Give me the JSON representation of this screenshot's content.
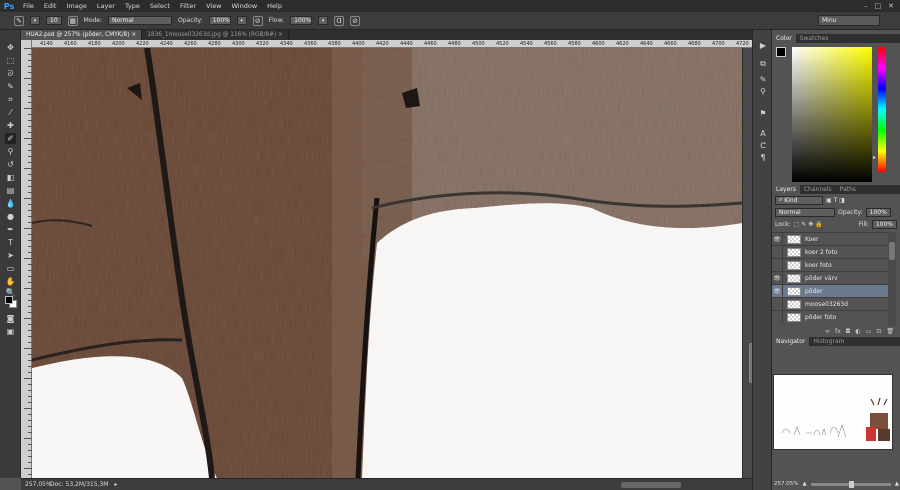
{
  "menubar": {
    "logo": "Ps",
    "items": [
      "File",
      "Edit",
      "Image",
      "Layer",
      "Type",
      "Select",
      "Filter",
      "View",
      "Window",
      "Help"
    ],
    "window_controls": [
      "–",
      "□",
      "✕"
    ]
  },
  "options": {
    "brush_size": "10",
    "mode_label": "Mode:",
    "mode_value": "Normal",
    "opacity_label": "Opacity:",
    "opacity_value": "100%",
    "flow_label": "Flow:",
    "flow_value": "100%",
    "workspace": "Minu"
  },
  "documents": {
    "tabs": [
      {
        "label": "HUA2.psd @ 257% (põder, CMYK/8)",
        "close": "×",
        "active": true
      },
      {
        "label": "1836_1moose03263d.jpg @ 116% (RGB/8#)",
        "close": "×",
        "active": false
      }
    ]
  },
  "ruler": {
    "ticks": [
      "4140",
      "4160",
      "4180",
      "4200",
      "4220",
      "4240",
      "4260",
      "4280",
      "4300",
      "4320",
      "4340",
      "4360",
      "4380",
      "4400",
      "4420",
      "4440",
      "4460",
      "4480",
      "4500",
      "4520",
      "4540",
      "4560",
      "4580",
      "4600",
      "4620",
      "4640",
      "4660",
      "4680",
      "4700",
      "4720"
    ]
  },
  "status": {
    "zoom": "257,05%",
    "doc_info": "Doc: 53,2M/315,3M",
    "arrow": "▸"
  },
  "color_panel": {
    "tabs": [
      "Color",
      "Swatches"
    ]
  },
  "layers_panel": {
    "tabs": [
      "Layers",
      "Channels",
      "Paths"
    ],
    "filter_label": "Kind",
    "blend_mode": "Normal",
    "opacity_label": "Opacity:",
    "opacity_value": "100%",
    "lock_label": "Lock:",
    "fill_label": "Fill:",
    "fill_value": "100%",
    "layers": [
      {
        "name": "Koer",
        "visible": true,
        "selected": false
      },
      {
        "name": "koer 2 foto",
        "visible": false,
        "selected": false
      },
      {
        "name": "koer foto",
        "visible": false,
        "selected": false
      },
      {
        "name": "põder värv",
        "visible": true,
        "selected": false
      },
      {
        "name": "põder",
        "visible": true,
        "selected": true
      },
      {
        "name": "moose03263d",
        "visible": false,
        "selected": false
      },
      {
        "name": "põder foto",
        "visible": false,
        "selected": false
      }
    ],
    "footer_icons": [
      "∞",
      "fx",
      "◘",
      "◐",
      "▭",
      "⊡",
      "🗑"
    ]
  },
  "navigator": {
    "tabs": [
      "Navigator",
      "Histogram"
    ],
    "zoom": "257,05%"
  },
  "colors": {
    "accent": "#3aa0ff",
    "selected_layer": "#6b7a8f",
    "fur_brown": "#6b4633"
  }
}
